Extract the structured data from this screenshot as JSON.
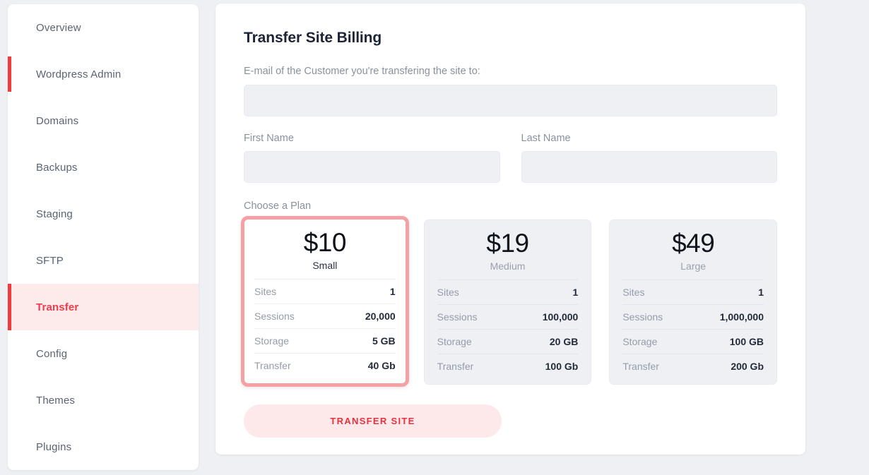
{
  "sidebar": {
    "items": [
      {
        "label": "Overview",
        "state": "default"
      },
      {
        "label": "Wordpress Admin",
        "state": "marked"
      },
      {
        "label": "Domains",
        "state": "default"
      },
      {
        "label": "Backups",
        "state": "default"
      },
      {
        "label": "Staging",
        "state": "default"
      },
      {
        "label": "SFTP",
        "state": "default"
      },
      {
        "label": "Transfer",
        "state": "active"
      },
      {
        "label": "Config",
        "state": "default"
      },
      {
        "label": "Themes",
        "state": "default"
      },
      {
        "label": "Plugins",
        "state": "default"
      }
    ]
  },
  "main": {
    "title": "Transfer Site Billing",
    "email": {
      "label": "E-mail of the Customer you're transfering the site to:",
      "value": "",
      "placeholder": ""
    },
    "first_name": {
      "label": "First Name",
      "value": "",
      "placeholder": ""
    },
    "last_name": {
      "label": "Last Name",
      "value": "",
      "placeholder": ""
    },
    "choose_plan_label": "Choose a Plan",
    "submit_label": "Transfer Site"
  },
  "plans": [
    {
      "price": "$10",
      "name": "Small",
      "selected": true,
      "specs": [
        {
          "key": "Sites",
          "value": "1"
        },
        {
          "key": "Sessions",
          "value": "20,000"
        },
        {
          "key": "Storage",
          "value": "5 GB"
        },
        {
          "key": "Transfer",
          "value": "40 Gb"
        }
      ]
    },
    {
      "price": "$19",
      "name": "Medium",
      "selected": false,
      "specs": [
        {
          "key": "Sites",
          "value": "1"
        },
        {
          "key": "Sessions",
          "value": "100,000"
        },
        {
          "key": "Storage",
          "value": "20 GB"
        },
        {
          "key": "Transfer",
          "value": "100 Gb"
        }
      ]
    },
    {
      "price": "$49",
      "name": "Large",
      "selected": false,
      "specs": [
        {
          "key": "Sites",
          "value": "1"
        },
        {
          "key": "Sessions",
          "value": "1,000,000"
        },
        {
          "key": "Storage",
          "value": "100 GB"
        },
        {
          "key": "Transfer",
          "value": "200 Gb"
        }
      ]
    }
  ],
  "colors": {
    "accent_red": "#ef3b4e",
    "accent_bar": "#ef3b3b",
    "active_bg": "#fdeaea",
    "selected_border": "#f5a0a3",
    "page_bg": "#eff0f4",
    "input_bg": "#eef0f4",
    "button_bg": "#fde9ea"
  }
}
